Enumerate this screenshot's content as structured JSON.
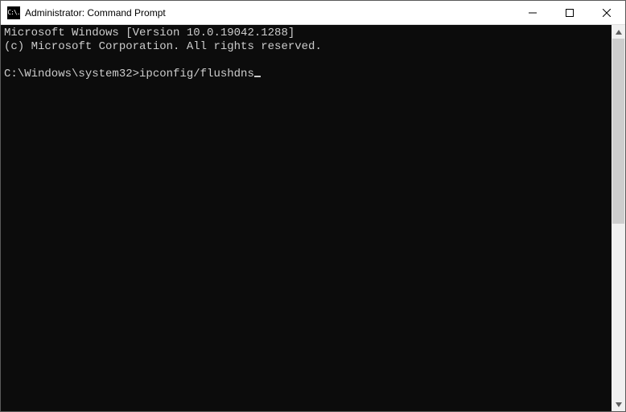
{
  "window": {
    "title": "Administrator: Command Prompt",
    "icon_glyph": "C:\\."
  },
  "terminal": {
    "line1": "Microsoft Windows [Version 10.0.19042.1288]",
    "line2": "(c) Microsoft Corporation. All rights reserved.",
    "blank": "",
    "prompt": "C:\\Windows\\system32>",
    "command": "ipconfig/flushdns"
  }
}
